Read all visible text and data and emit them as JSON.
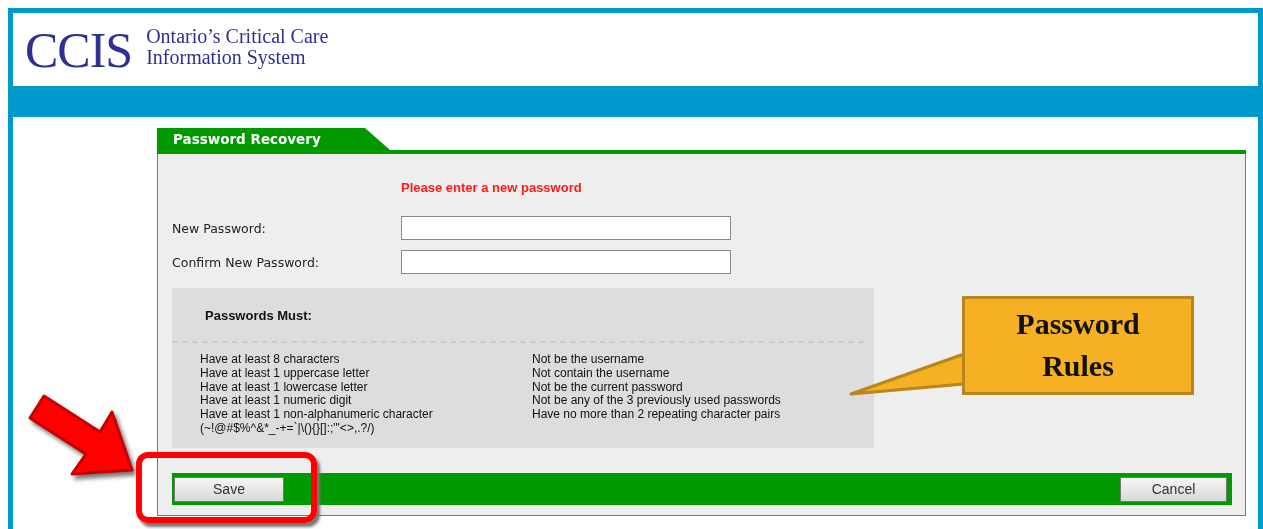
{
  "header": {
    "logo": "CCIS",
    "subtitle_line_1": "Ontario’s Critical Care",
    "subtitle_line_2": "Information System"
  },
  "panel": {
    "tab": "Password Recovery",
    "message": "Please enter a new password",
    "fields": [
      {
        "label": "New Password:"
      },
      {
        "label": "Confirm New Password:"
      }
    ],
    "rules": {
      "title": "Passwords Must:",
      "left": [
        "Have at least 8 characters",
        "Have at least 1 uppercase letter",
        "Have at least 1 lowercase letter",
        "Have at least 1 numeric digit",
        "Have at least 1 non-alphanumeric character",
        "(~!@#$%^&*_-+=`|\\(){}[]:;\"'<>,.?/)"
      ],
      "right": [
        "Not be the username",
        "Not contain the username",
        "Not be the current password",
        "Not be any of the 3 previously used passwords",
        "Have no more than 2 repeating character pairs"
      ]
    },
    "buttons": [
      {
        "label": "Save",
        "kind": "primary"
      },
      {
        "label": "Cancel",
        "kind": "secondary"
      }
    ]
  },
  "annotations": {
    "callout": "Password Rules"
  }
}
